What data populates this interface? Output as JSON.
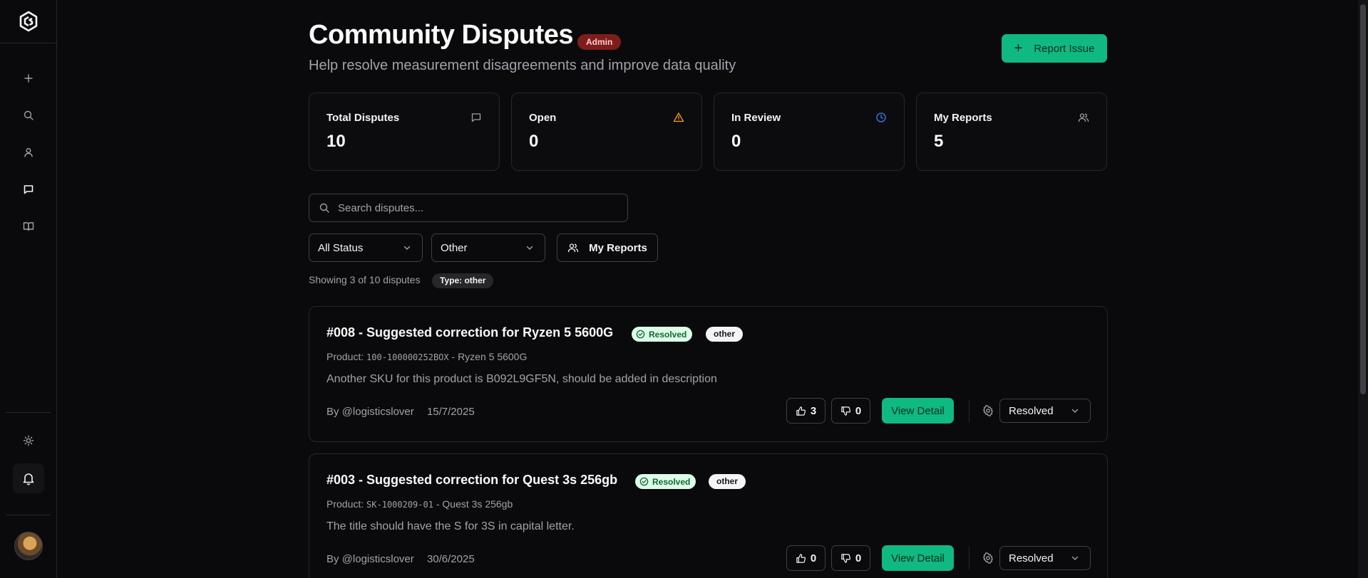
{
  "page": {
    "title": "Community Disputes",
    "role_badge": "Admin",
    "subtitle": "Help resolve measurement disagreements and improve data quality",
    "report_button": "Report Issue"
  },
  "stats": [
    {
      "label": "Total Disputes",
      "value": "10",
      "icon": "message-square-icon"
    },
    {
      "label": "Open",
      "value": "0",
      "icon": "alert-triangle-icon",
      "color": "#f59e0b"
    },
    {
      "label": "In Review",
      "value": "0",
      "icon": "clock-icon",
      "color": "#3b82f6"
    },
    {
      "label": "My Reports",
      "value": "5",
      "icon": "users-icon"
    }
  ],
  "filters": {
    "search_placeholder": "Search disputes...",
    "status_selected": "All Status",
    "type_selected": "Other",
    "my_reports_label": "My Reports",
    "showing_text": "Showing 3 of 10 disputes",
    "active_filter_chip": "Type: other"
  },
  "disputes": [
    {
      "title": "#008 - Suggested correction for Ryzen 5 5600G",
      "status": "Resolved",
      "type": "other",
      "product_label": "Product:",
      "sku": "100-100000252BOX",
      "product_name": "- Ryzen 5 5600G",
      "description": "Another SKU for this product is B092L9GF5N, should be added in description",
      "author": "By @logisticslover",
      "date": "15/7/2025",
      "upvotes": "3",
      "downvotes": "0",
      "view_label": "View Detail",
      "status_select": "Resolved"
    },
    {
      "title": "#003 - Suggested correction for Quest 3s 256gb",
      "status": "Resolved",
      "type": "other",
      "product_label": "Product:",
      "sku": "SK-1000209-01",
      "product_name": "- Quest 3s 256gb",
      "description": "The title should have the S for 3S in capital letter.",
      "author": "By @logisticslover",
      "date": "30/6/2025",
      "upvotes": "0",
      "downvotes": "0",
      "view_label": "View Detail",
      "status_select": "Resolved"
    }
  ],
  "colors": {
    "accent": "#10b981",
    "background": "#0a0a0c",
    "admin_badge": "#7f1d1d",
    "resolved_pill": "#dcfce7"
  }
}
